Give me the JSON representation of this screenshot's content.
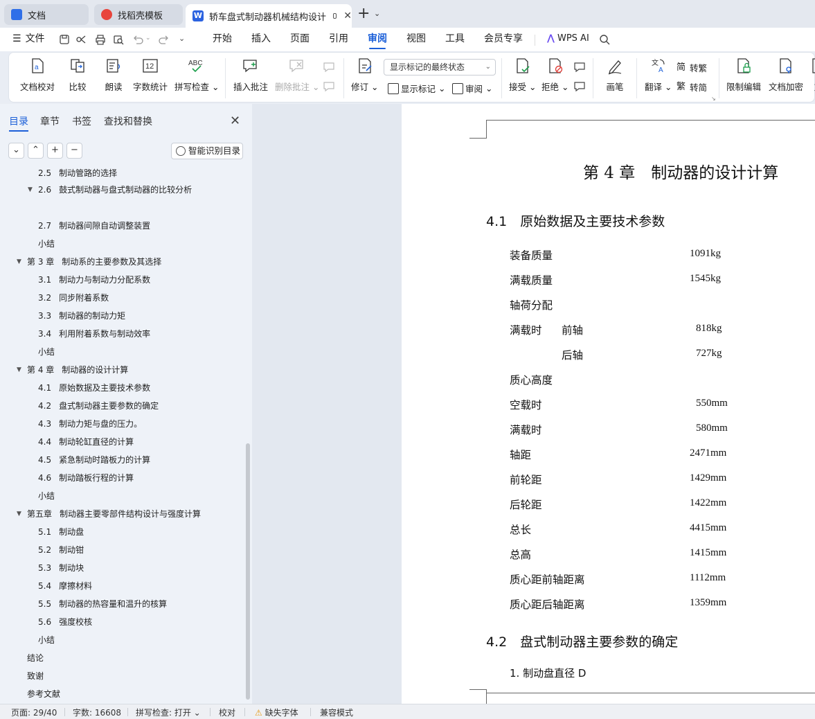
{
  "tabs": [
    {
      "label": "文档",
      "icon": "doc-icon",
      "color": "#2f6fe8"
    },
    {
      "label": "找稻壳模板",
      "icon": "docer-icon",
      "color": "#e8443c"
    },
    {
      "label": "轿车盘式制动器机械结构设计",
      "icon": "word-icon",
      "color": "#2b62e0"
    }
  ],
  "menu": {
    "file": "文件",
    "items": [
      "开始",
      "插入",
      "页面",
      "引用",
      "审阅",
      "视图",
      "工具",
      "会员专享"
    ],
    "active": "审阅",
    "wps_ai": "WPS AI"
  },
  "ribbon": {
    "doc_check": "文档校对",
    "compare": "比较",
    "read_aloud": "朗读",
    "word_count": "字数统计",
    "spell_check": "拼写检查",
    "insert_comment": "插入批注",
    "delete_comment": "删除批注",
    "revise": "修订",
    "markup_state": "显示标记的最终状态",
    "show_markup": "显示标记",
    "review": "审阅",
    "accept": "接受",
    "reject": "拒绝",
    "pen": "画笔",
    "translate": "翻译",
    "to_traditional": "转繁",
    "to_simplified": "转简",
    "restrict_edit": "限制编辑",
    "doc_encrypt": "文档加密",
    "cut_off": "文"
  },
  "panel": {
    "tabs": [
      "目录",
      "章节",
      "书签",
      "查找和替换"
    ],
    "active_tab": "目录",
    "smart_toc": "智能识别目录"
  },
  "toc": [
    {
      "num": "2.5",
      "text": "制动管路的选择",
      "level": 2
    },
    {
      "num": "2.6",
      "text": "鼓式制动器与盘式制动器的比较分析",
      "level": 2,
      "expand": true
    },
    {
      "num": "2.7",
      "text": "制动器间隙自动调整装置",
      "level": 2
    },
    {
      "num": "",
      "text": "小结",
      "level": 2
    },
    {
      "num": "第 3 章",
      "text": "制动系的主要参数及其选择",
      "level": 1,
      "expand": true
    },
    {
      "num": "3.1",
      "text": "制动力与制动力分配系数",
      "level": 2
    },
    {
      "num": "3.2",
      "text": "同步附着系数",
      "level": 2
    },
    {
      "num": "3.3",
      "text": "制动器的制动力矩",
      "level": 2
    },
    {
      "num": "3.4",
      "text": "利用附着系数与制动效率",
      "level": 2
    },
    {
      "num": "",
      "text": "小结",
      "level": 2
    },
    {
      "num": "第 4 章",
      "text": "制动器的设计计算",
      "level": 1,
      "expand": true
    },
    {
      "num": "4.1",
      "text": "原始数据及主要技术参数",
      "level": 2
    },
    {
      "num": "4.2",
      "text": "盘式制动器主要参数的确定",
      "level": 2
    },
    {
      "num": "4.3",
      "text": "制动力矩与盘的压力。",
      "level": 2
    },
    {
      "num": "4.4",
      "text": "制动轮缸直径的计算",
      "level": 2
    },
    {
      "num": "4.5",
      "text": "紧急制动时踏板力的计算",
      "level": 2
    },
    {
      "num": "4.6",
      "text": "制动踏板行程的计算",
      "level": 2
    },
    {
      "num": "",
      "text": "小结",
      "level": 2
    },
    {
      "num": "第五章",
      "text": "制动器主要零部件结构设计与强度计算",
      "level": 1,
      "expand": true
    },
    {
      "num": "5.1",
      "text": "制动盘",
      "level": 2
    },
    {
      "num": "5.2",
      "text": "制动钳",
      "level": 2
    },
    {
      "num": "5.3",
      "text": "制动块",
      "level": 2
    },
    {
      "num": "5.4",
      "text": "摩擦材料",
      "level": 2
    },
    {
      "num": "5.5",
      "text": "制动器的热容量和温升的核算",
      "level": 2
    },
    {
      "num": "5.6",
      "text": "强度校核",
      "level": 2
    },
    {
      "num": "",
      "text": "小结",
      "level": 2
    },
    {
      "num": "",
      "text": "结论",
      "level": 1
    },
    {
      "num": "",
      "text": "致谢",
      "level": 1
    },
    {
      "num": "",
      "text": "参考文献",
      "level": 1
    }
  ],
  "document": {
    "chapter_title": "第 4 章　制动器的设计计算",
    "section1_title": "4.1　原始数据及主要技术参数",
    "params": [
      {
        "label": "装备质量",
        "value": "1091kg"
      },
      {
        "label": "满载质量",
        "value": "1545kg"
      },
      {
        "label": "轴荷分配",
        "value": ""
      },
      {
        "label": "满载时",
        "sub": "前轴",
        "value": "818kg"
      },
      {
        "label": "",
        "sub": "后轴",
        "value": "727kg"
      },
      {
        "label": "质心高度",
        "value": ""
      },
      {
        "label": "空载时",
        "value": "550mm"
      },
      {
        "label": "满载时",
        "value": "580mm"
      },
      {
        "label": "轴距",
        "value": "2471mm"
      },
      {
        "label": "前轮距",
        "value": "1429mm"
      },
      {
        "label": "后轮距",
        "value": "1422mm"
      },
      {
        "label": "总长",
        "value": "4415mm"
      },
      {
        "label": "总高",
        "value": "1415mm"
      },
      {
        "label": "质心距前轴距离",
        "value": "1112mm"
      },
      {
        "label": "质心距后轴距离",
        "value": "1359mm"
      }
    ],
    "section2_title": "4.2　盘式制动器主要参数的确定",
    "item1": "1.  制动盘直径 D"
  },
  "status": {
    "page": "页面: 29/40",
    "words": "字数: 16608",
    "spell": "拼写检查: 打开",
    "proof": "校对",
    "missing_font": "缺失字体",
    "compat": "兼容模式"
  }
}
